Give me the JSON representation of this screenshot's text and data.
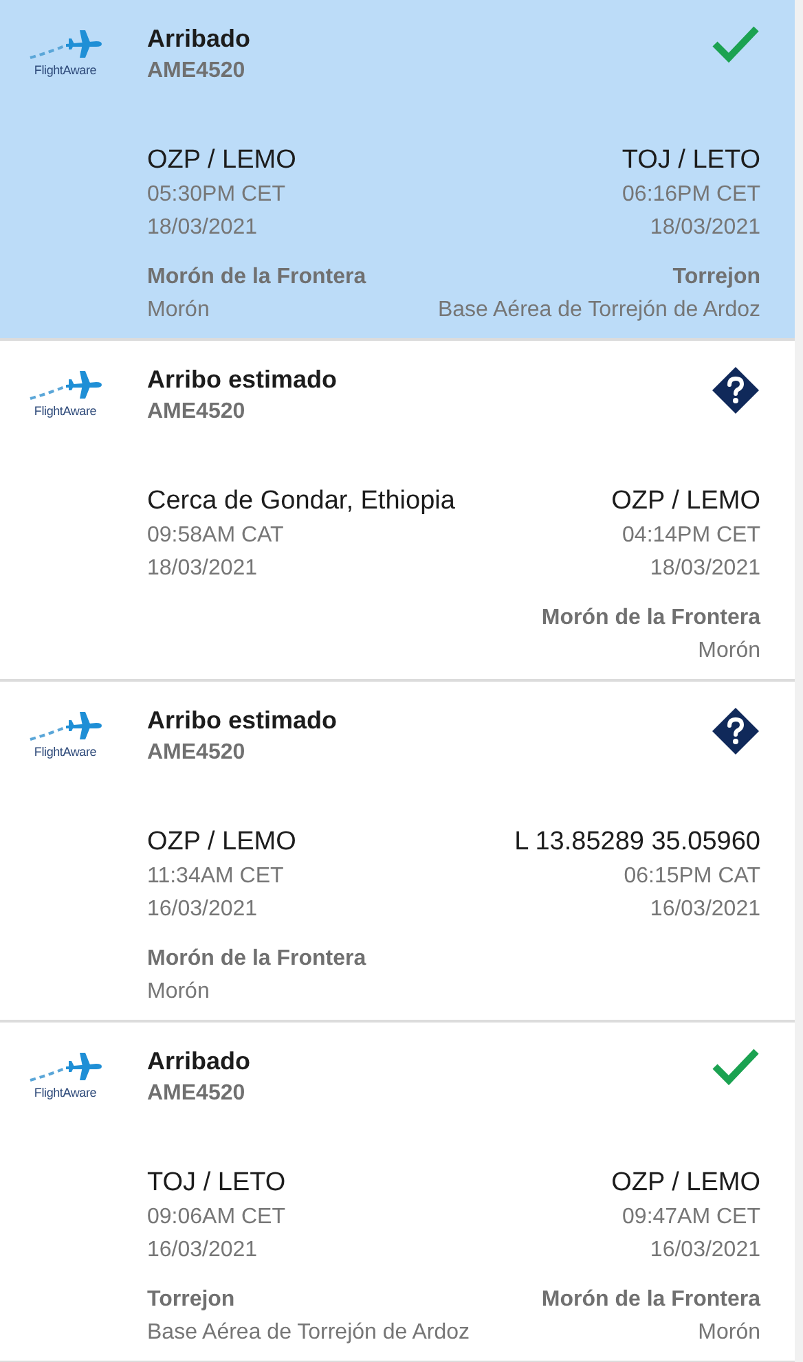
{
  "flights": [
    {
      "selected": true,
      "logo_text": "FlightAware",
      "status": {
        "kind": "arrived",
        "label": "Arribado"
      },
      "flight": "AME4520",
      "origin": {
        "code": "OZP / LEMO",
        "time": "05:30PM CET",
        "date": "18/03/2021",
        "name": "Morón de la Frontera",
        "city": "Morón"
      },
      "destination": {
        "code": "TOJ / LETO",
        "time": "06:16PM CET",
        "date": "18/03/2021",
        "name": "Torrejon",
        "city": "Base Aérea de Torrejón de Ardoz"
      }
    },
    {
      "selected": false,
      "logo_text": "FlightAware",
      "status": {
        "kind": "estimated",
        "label": "Arribo estimado"
      },
      "flight": "AME4520",
      "origin": {
        "code": "Cerca de Gondar, Ethiopia",
        "time": "09:58AM CAT",
        "date": "18/03/2021"
      },
      "destination": {
        "code": "OZP / LEMO",
        "time": "04:14PM CET",
        "date": "18/03/2021",
        "name": "Morón de la Frontera",
        "city": "Morón"
      }
    },
    {
      "selected": false,
      "logo_text": "FlightAware",
      "status": {
        "kind": "estimated",
        "label": "Arribo estimado"
      },
      "flight": "AME4520",
      "origin": {
        "code": "OZP / LEMO",
        "time": "11:34AM CET",
        "date": "16/03/2021",
        "name": "Morón de la Frontera",
        "city": "Morón"
      },
      "destination": {
        "code": "L 13.85289 35.05960",
        "time": "06:15PM CAT",
        "date": "16/03/2021"
      }
    },
    {
      "selected": false,
      "logo_text": "FlightAware",
      "status": {
        "kind": "arrived",
        "label": "Arribado"
      },
      "flight": "AME4520",
      "origin": {
        "code": "TOJ / LETO",
        "time": "09:06AM CET",
        "date": "16/03/2021",
        "name": "Torrejon",
        "city": "Base Aérea de Torrejón de Ardoz"
      },
      "destination": {
        "code": "OZP / LEMO",
        "time": "09:47AM CET",
        "date": "16/03/2021",
        "name": "Morón de la Frontera",
        "city": "Morón"
      }
    }
  ]
}
